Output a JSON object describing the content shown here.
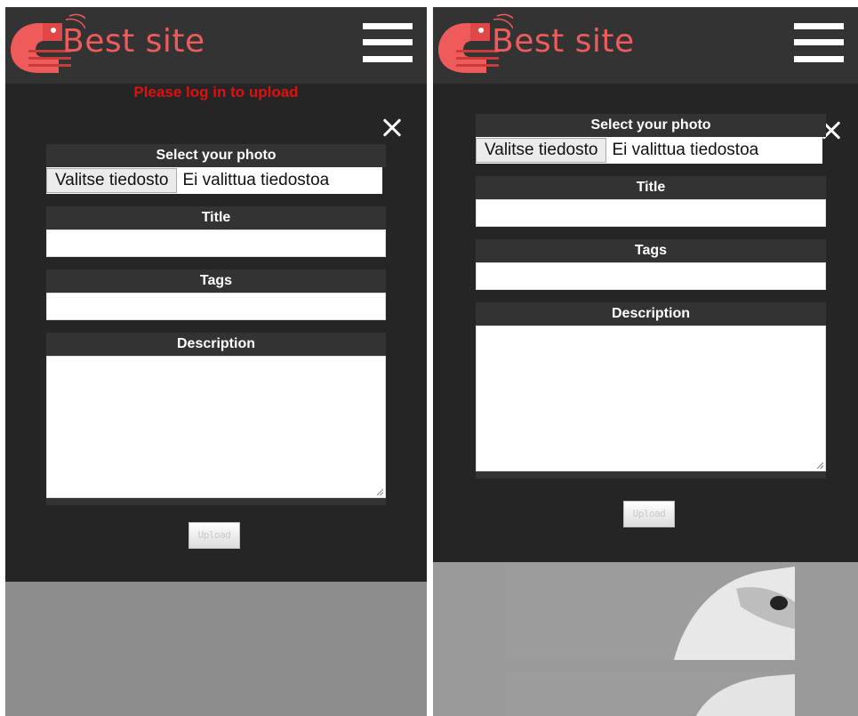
{
  "site": {
    "title": "Best site"
  },
  "left": {
    "warning": "Please log in to upload",
    "form": {
      "photo_label": "Select your photo",
      "file_button": "Valitse tiedosto",
      "file_status": "Ei valittua tiedostoa",
      "title_label": "Title",
      "tags_label": "Tags",
      "description_label": "Description",
      "upload_button": "Upload"
    }
  },
  "right": {
    "form": {
      "photo_label": "Select your photo",
      "file_button": "Valitse tiedosto",
      "file_status": "Ei valittua tiedostoa",
      "title_label": "Title",
      "tags_label": "Tags",
      "description_label": "Description",
      "upload_button": "Upload"
    }
  },
  "icons": {
    "logo": "shrimp-logo-icon",
    "menu": "hamburger-menu-icon",
    "close": "close-icon"
  },
  "colors": {
    "accent": "#ef5b5b",
    "warning": "#e01010",
    "background": "#252525",
    "header": "#333333"
  }
}
